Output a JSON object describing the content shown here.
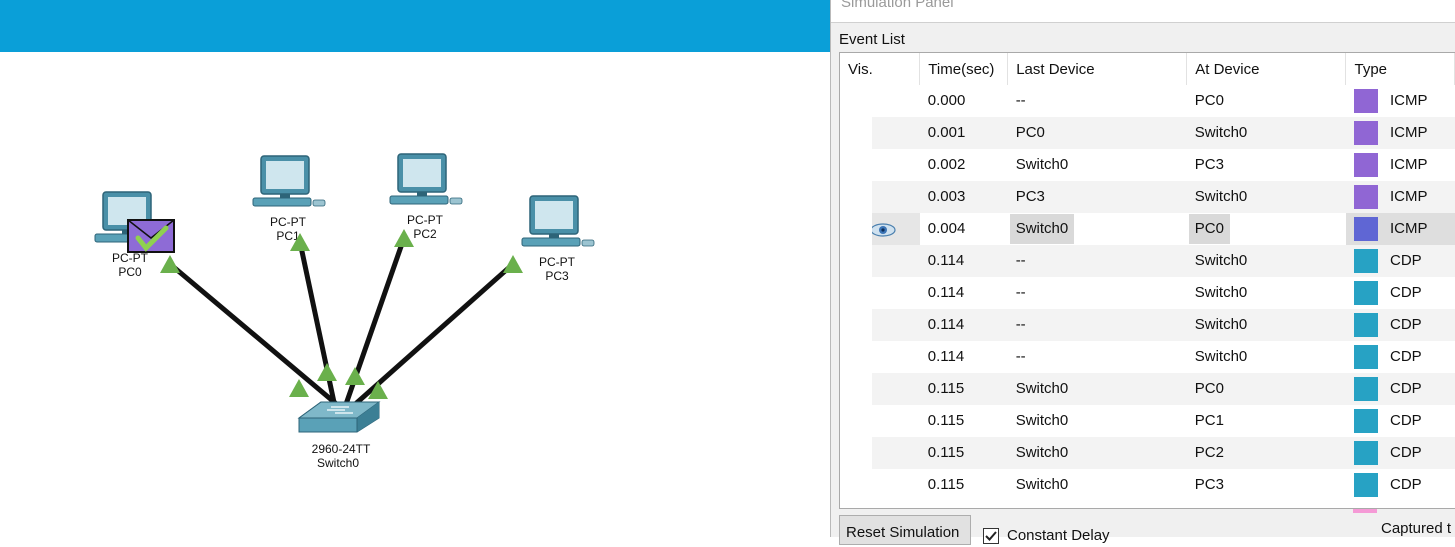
{
  "workspace": {
    "devices": [
      {
        "type": "PC-PT",
        "name": "PC0"
      },
      {
        "type": "PC-PT",
        "name": "PC1"
      },
      {
        "type": "PC-PT",
        "name": "PC2"
      },
      {
        "type": "PC-PT",
        "name": "PC3"
      },
      {
        "type": "2960-24TT",
        "name": "Switch0"
      }
    ],
    "link_status_color": "#6ab04c",
    "pdu_color": "#8e6bd6"
  },
  "panel": {
    "title": "Simulation Panel",
    "event_list_label": "Event List",
    "columns": [
      "Vis.",
      "Time(sec)",
      "Last Device",
      "At Device",
      "Type"
    ],
    "events": [
      {
        "vis": "",
        "time": "0.000",
        "last": "--",
        "at": "PC0",
        "type": "ICMP",
        "color": "#9066d4"
      },
      {
        "vis": "",
        "time": "0.001",
        "last": "PC0",
        "at": "Switch0",
        "type": "ICMP",
        "color": "#9066d4"
      },
      {
        "vis": "",
        "time": "0.002",
        "last": "Switch0",
        "at": "PC3",
        "type": "ICMP",
        "color": "#9066d4"
      },
      {
        "vis": "",
        "time": "0.003",
        "last": "PC3",
        "at": "Switch0",
        "type": "ICMP",
        "color": "#9066d4"
      },
      {
        "vis": "eye-icon",
        "time": "0.004",
        "last": "Switch0",
        "at": "PC0",
        "type": "ICMP",
        "color": "#5f66d4",
        "selected": true
      },
      {
        "vis": "",
        "time": "0.114",
        "last": "--",
        "at": "Switch0",
        "type": "CDP",
        "color": "#27a2c4"
      },
      {
        "vis": "",
        "time": "0.114",
        "last": "--",
        "at": "Switch0",
        "type": "CDP",
        "color": "#27a2c4"
      },
      {
        "vis": "",
        "time": "0.114",
        "last": "--",
        "at": "Switch0",
        "type": "CDP",
        "color": "#27a2c4"
      },
      {
        "vis": "",
        "time": "0.114",
        "last": "--",
        "at": "Switch0",
        "type": "CDP",
        "color": "#27a2c4"
      },
      {
        "vis": "",
        "time": "0.115",
        "last": "Switch0",
        "at": "PC0",
        "type": "CDP",
        "color": "#27a2c4"
      },
      {
        "vis": "",
        "time": "0.115",
        "last": "Switch0",
        "at": "PC1",
        "type": "CDP",
        "color": "#27a2c4"
      },
      {
        "vis": "",
        "time": "0.115",
        "last": "Switch0",
        "at": "PC2",
        "type": "CDP",
        "color": "#27a2c4"
      },
      {
        "vis": "",
        "time": "0.115",
        "last": "Switch0",
        "at": "PC3",
        "type": "CDP",
        "color": "#27a2c4"
      }
    ],
    "reset_label": "Reset Simulation",
    "constant_delay_label": "Constant Delay",
    "constant_delay_checked": true,
    "captured_label": "Captured t"
  }
}
